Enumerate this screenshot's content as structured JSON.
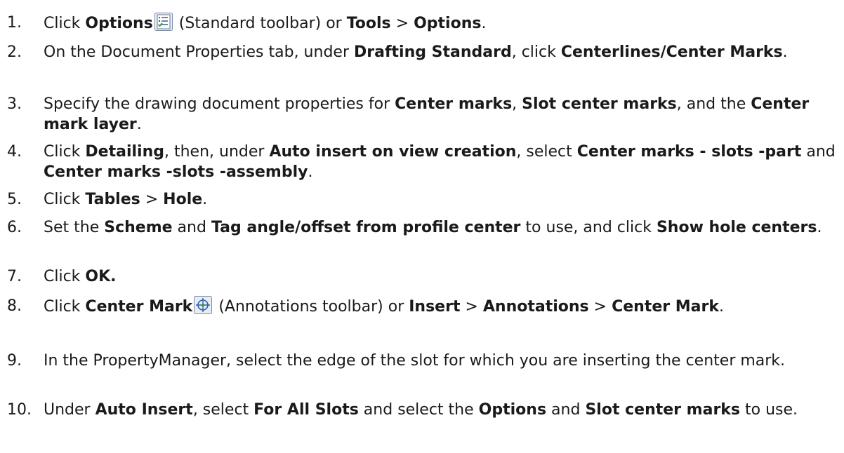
{
  "steps": [
    {
      "num": "1.",
      "parts": [
        {
          "t": "Click ",
          "b": false
        },
        {
          "t": "Options",
          "b": true
        },
        {
          "icon": "options-icon"
        },
        {
          "t": " (Standard toolbar) or ",
          "b": false
        },
        {
          "t": "Tools",
          "b": true
        },
        {
          "t": " > ",
          "b": false
        },
        {
          "t": "Options",
          "b": true
        },
        {
          "t": ".",
          "b": false
        }
      ]
    },
    {
      "num": "2.",
      "parts": [
        {
          "t": "On the Document Properties tab, under ",
          "b": false
        },
        {
          "t": "Drafting Standard",
          "b": true
        },
        {
          "t": ", click ",
          "b": false
        },
        {
          "t": "Centerlines/Center Marks",
          "b": true
        },
        {
          "t": ".",
          "b": false
        }
      ]
    },
    {
      "num": "3.",
      "parts": [
        {
          "t": "Specify the drawing document properties for ",
          "b": false
        },
        {
          "t": "Center marks",
          "b": true
        },
        {
          "t": ", ",
          "b": false
        },
        {
          "t": "Slot center marks",
          "b": true
        },
        {
          "t": ", and the ",
          "b": false
        },
        {
          "t": "Center mark layer",
          "b": true
        },
        {
          "t": ".",
          "b": false
        }
      ]
    },
    {
      "num": "4.",
      "parts": [
        {
          "t": "Click ",
          "b": false
        },
        {
          "t": "Detailing",
          "b": true
        },
        {
          "t": ", then, under ",
          "b": false
        },
        {
          "t": "Auto insert on view creation",
          "b": true
        },
        {
          "t": ", select ",
          "b": false
        },
        {
          "t": "Center marks - slots -part",
          "b": true
        },
        {
          "t": " and ",
          "b": false
        },
        {
          "t": "Center marks -slots -assembly",
          "b": true
        },
        {
          "t": ".",
          "b": false
        }
      ]
    },
    {
      "num": "5.",
      "parts": [
        {
          "t": "Click ",
          "b": false
        },
        {
          "t": "Tables",
          "b": true
        },
        {
          "t": " > ",
          "b": false
        },
        {
          "t": "Hole",
          "b": true
        },
        {
          "t": ".",
          "b": false
        }
      ]
    },
    {
      "num": "6.",
      "parts": [
        {
          "t": "Set the ",
          "b": false
        },
        {
          "t": "Scheme",
          "b": true
        },
        {
          "t": " and ",
          "b": false
        },
        {
          "t": "Tag angle/offset from profile center",
          "b": true
        },
        {
          "t": " to use, and click ",
          "b": false
        },
        {
          "t": "Show hole centers",
          "b": true
        },
        {
          "t": ".",
          "b": false
        }
      ]
    },
    {
      "num": "7.",
      "parts": [
        {
          "t": "Click ",
          "b": false
        },
        {
          "t": "OK.",
          "b": true
        }
      ]
    },
    {
      "num": "8.",
      "parts": [
        {
          "t": "Click ",
          "b": false
        },
        {
          "t": "Center Mark",
          "b": true
        },
        {
          "icon": "center-mark-icon"
        },
        {
          "t": " (Annotations toolbar) or ",
          "b": false
        },
        {
          "t": "Insert",
          "b": true
        },
        {
          "t": " > ",
          "b": false
        },
        {
          "t": "Annotations",
          "b": true
        },
        {
          "t": " > ",
          "b": false
        },
        {
          "t": "Center Mark",
          "b": true
        },
        {
          "t": ".",
          "b": false
        }
      ]
    },
    {
      "num": "9.",
      "parts": [
        {
          "t": "In the PropertyManager, select the edge of the slot for which you are inserting the center mark.",
          "b": false
        }
      ]
    },
    {
      "num": "10.",
      "parts": [
        {
          "t": "Under ",
          "b": false
        },
        {
          "t": "Auto Insert",
          "b": true
        },
        {
          "t": ", select ",
          "b": false
        },
        {
          "t": "For All Slots",
          "b": true
        },
        {
          "t": " and select the ",
          "b": false
        },
        {
          "t": "Options",
          "b": true
        },
        {
          "t": " and ",
          "b": false
        },
        {
          "t": "Slot center marks",
          "b": true
        },
        {
          "t": " to use.",
          "b": false
        }
      ]
    }
  ]
}
